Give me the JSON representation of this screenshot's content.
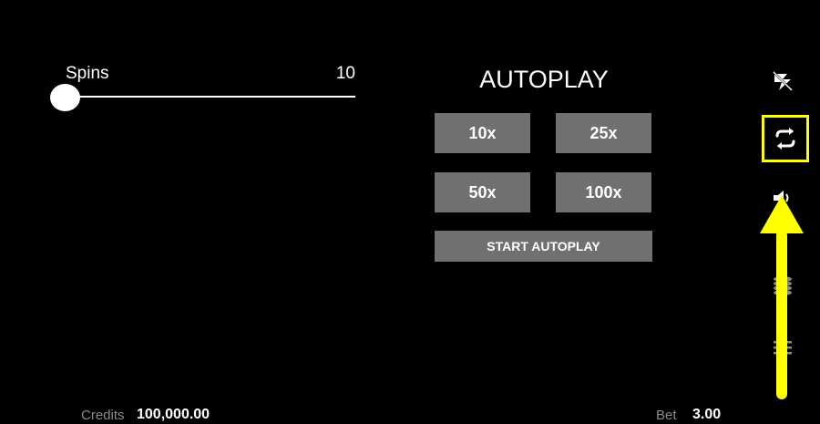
{
  "spins": {
    "label": "Spins",
    "value": "10",
    "slider_fraction": 0
  },
  "autoplay": {
    "title": "AUTOPLAY",
    "options": [
      "10x",
      "25x",
      "50x",
      "100x"
    ],
    "start_label": "START AUTOPLAY"
  },
  "rail": {
    "icons": [
      "turbo-icon",
      "autoplay-icon",
      "sound-icon",
      "coins-icon",
      "menu-icon"
    ],
    "highlight_color": "#ffff00",
    "arrow_color": "#ffff00"
  },
  "footer": {
    "credits_label": "Credits",
    "credits_value": "100,000.00",
    "bet_label": "Bet",
    "bet_value": "3.00"
  },
  "colors": {
    "background": "#000000",
    "button": "#707070",
    "text": "#ffffff",
    "muted_text": "#8a8a8a"
  }
}
